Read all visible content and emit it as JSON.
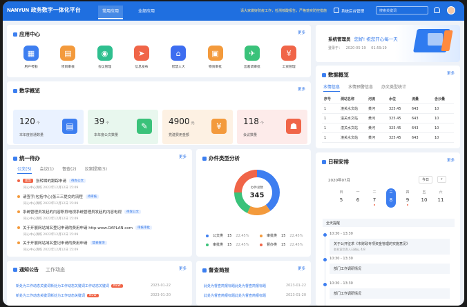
{
  "topbar": {
    "logo_en": "NANYUN",
    "logo_cn": "政务数字一体化平台",
    "nav": [
      "常用应用",
      "全部应用"
    ],
    "notice": "请大家做好防疫工作，检测核酸报告，严格落实防控措施",
    "manage": "系统后台管理",
    "search_placeholder": "搜索关键词"
  },
  "app_center": {
    "title": "应用中心",
    "more": "更多",
    "apps": [
      {
        "label": "用户考勤",
        "icon": "calendar-icon",
        "color": "#3d7ef0",
        "glyph": "▦"
      },
      {
        "label": "项目审核",
        "icon": "document-icon",
        "color": "#f39a3c",
        "glyph": "▤"
      },
      {
        "label": "会议管理",
        "icon": "meeting-icon",
        "color": "#2fbf8f",
        "glyph": "◉"
      },
      {
        "label": "信息发布",
        "icon": "send-icon",
        "color": "#f06548",
        "glyph": "➤"
      },
      {
        "label": "智慧人大",
        "icon": "building-icon",
        "color": "#3d6df0",
        "glyph": "⌂"
      },
      {
        "label": "物资审批",
        "icon": "box-icon",
        "color": "#f39a3c",
        "glyph": "▣"
      },
      {
        "label": "出差调审批",
        "icon": "plane-icon",
        "color": "#3ac27a",
        "glyph": "✈"
      },
      {
        "label": "工资管理",
        "icon": "wallet-icon",
        "color": "#f06548",
        "glyph": "¥"
      }
    ]
  },
  "data_overview": {
    "title": "数字概览",
    "more": "更多",
    "stats": [
      {
        "num": "120",
        "unit": "个",
        "label": "本年度普通数量",
        "bg": "#eaf2ff",
        "ic": "#3d7ef0",
        "icon": "clipboard-icon",
        "glyph": "▤"
      },
      {
        "num": "39",
        "unit": "个",
        "label": "本年度公文数量",
        "bg": "#e8f7ee",
        "ic": "#3ac27a",
        "icon": "edit-icon",
        "glyph": "✎"
      },
      {
        "num": "4900",
        "unit": "元",
        "label": "党建费用金额",
        "bg": "#fdf1e3",
        "ic": "#f39a3c",
        "icon": "wallet-icon",
        "glyph": "¥"
      },
      {
        "num": "118",
        "unit": "个",
        "label": "会议数量",
        "bg": "#fdebea",
        "ic": "#f06548",
        "icon": "people-icon",
        "glyph": "☗"
      }
    ]
  },
  "todo": {
    "title": "统一待办",
    "more": "更多",
    "tabs": [
      "公文(5)",
      "会议(1)",
      "督查(2)",
      "议案提案(5)"
    ],
    "items": [
      {
        "tag_pre": "紧急",
        "text": "张转瞬的跟踪申请",
        "tag": "待办公文",
        "date": "同心中心演练      2022年12月12日 15:09",
        "dot": "#f06548"
      },
      {
        "tag_pre": "",
        "text": "请签字(包括中心)张三三提交的流程",
        "tag": "待审核",
        "date": "同心中心演练      2022年12月12日 15:09",
        "dot": "#f39a3c"
      },
      {
        "tag_pre": "",
        "text": "系统管理员发起的内容职称电视系统管理员发起的内容电视",
        "tag": "待发公文",
        "date": "同心中心演练      2022年12月12日 15:09",
        "dot": "#f39a3c"
      },
      {
        "tag_pre": "",
        "text": "关于开展网站域名登记申请的费用申请 http:www.OAPLAN.com",
        "tag": "审核审批",
        "date": "同心中心演练      2022年12月12日 15:09",
        "dot": "#f39a3c"
      },
      {
        "tag_pre": "",
        "text": "关于开展网站域名登记申请的费用申请",
        "tag": "督查查询",
        "date": "同心中心演练      2022年12月12日 15:09",
        "dot": "#f39a3c"
      }
    ]
  },
  "doc_analysis": {
    "title": "办件类型分析",
    "center_label": "办件总数",
    "center_value": "345",
    "chart_data": {
      "type": "pie",
      "title": "办件类型分析",
      "categories": [
        "公文类",
        "审批类",
        "审批类",
        "督办类"
      ],
      "values": [
        15,
        15,
        15,
        15
      ],
      "percents": [
        "22.45%",
        "22.45%",
        "22.45%",
        "22.45%"
      ],
      "colors": [
        "#3d7ef0",
        "#f39a3c",
        "#3ac27a",
        "#f06548"
      ]
    },
    "legend": [
      {
        "name": "公文类",
        "value": "15",
        "pct": "22.45%",
        "color": "#3d7ef0"
      },
      {
        "name": "审批类",
        "value": "15",
        "pct": "22.45%",
        "color": "#f39a3c"
      },
      {
        "name": "审批类",
        "value": "15",
        "pct": "22.45%",
        "color": "#3ac27a"
      },
      {
        "name": "督办类",
        "value": "15",
        "pct": "22.45%",
        "color": "#f06548"
      }
    ]
  },
  "notices": {
    "tabs": [
      "通知公告",
      "工作动态"
    ],
    "more": "更多",
    "items": [
      {
        "text": "新处为工作动态关键词新处为工作动态关键词工作动态关键词",
        "new": "NEW",
        "date": "2023-01-22"
      },
      {
        "text": "新处为工作动态关键词新处为工作动态关键词",
        "new": "NEW",
        "date": "2023-01-20"
      }
    ]
  },
  "supervision": {
    "title": "督查简报",
    "more": "更多",
    "items": [
      {
        "text": "此处为督查简报标题此处为督查简报标题",
        "date": "2023-01-22"
      },
      {
        "text": "此处为督查简报标题此处为督查简报标题",
        "date": "2023-01-20"
      }
    ]
  },
  "welcome": {
    "name": "系统管理员",
    "greeting": "您好! 祝您开心每一天",
    "login_label": "登录于：",
    "date": "2020-05-19",
    "time": "01:59:19"
  },
  "data_panel": {
    "title": "数据概览",
    "more": "更多",
    "tabs": [
      "水情信息",
      "水情预警信息",
      "办文类型统计"
    ],
    "headers": [
      "序号",
      "测站名称",
      "河流",
      "水位",
      "流量",
      "含沙量"
    ],
    "rows": [
      [
        "1",
        "潼关水文站",
        "黄河",
        "325.45",
        "643",
        "10"
      ],
      [
        "1",
        "潼关水文站",
        "黄河",
        "325.45",
        "643",
        "10"
      ],
      [
        "1",
        "潼关水文站",
        "黄河",
        "325.45",
        "643",
        "10"
      ],
      [
        "1",
        "潼关水文站",
        "黄河",
        "325.45",
        "643",
        "10"
      ]
    ]
  },
  "schedule": {
    "title": "日程安排",
    "more": "更多",
    "month": "2020年07月",
    "today_btn": "今日",
    "weekdays": [
      "日",
      "一",
      "二",
      "三",
      "四",
      "五",
      "六"
    ],
    "days": [
      "5",
      "6",
      "7",
      "8",
      "9",
      "10",
      "11"
    ],
    "all_day": "全天提醒",
    "events": [
      {
        "time": "10:30 - 13:30",
        "text": "关于公开征求《市财政专项资金管理的实施意见》",
        "sub": "各科室负责人已确认 4/8"
      },
      {
        "time": "10:30 - 13:30",
        "text": "部门工作调研情况",
        "sub": ""
      },
      {
        "time": "10:30 - 13:30",
        "text": "部门工作调研情况",
        "sub": ""
      }
    ]
  },
  "watermark": "千库网"
}
